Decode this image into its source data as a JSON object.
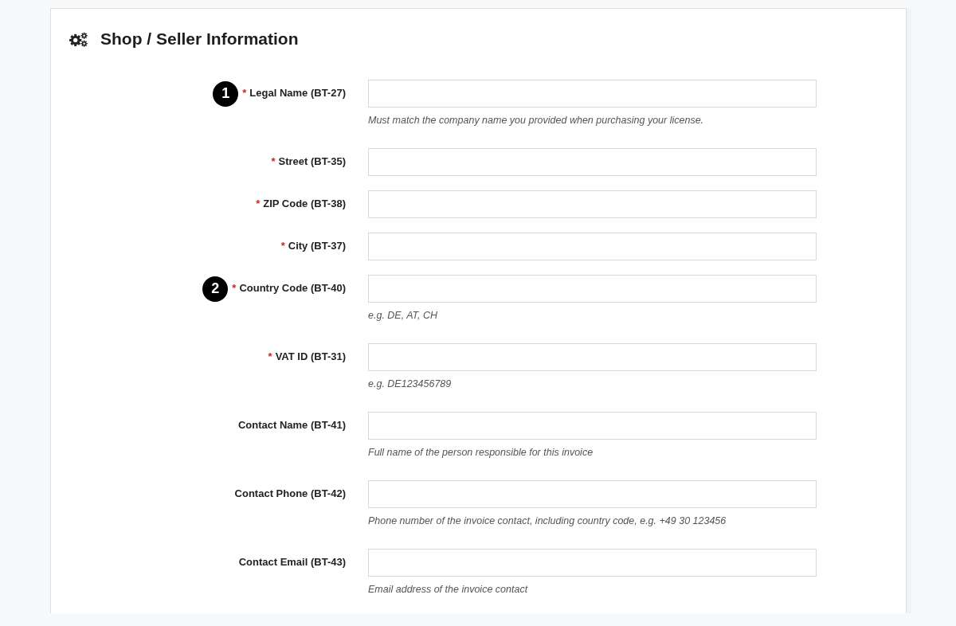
{
  "section": {
    "title": "Shop / Seller Information"
  },
  "fields": [
    {
      "label": "Legal Name (BT-27)",
      "required_mark": "*",
      "badge": "1",
      "help": "Must match the company name you provided when purchasing your license."
    },
    {
      "label": "Street (BT-35)",
      "required_mark": "*"
    },
    {
      "label": "ZIP Code (BT-38)",
      "required_mark": "*"
    },
    {
      "label": "City (BT-37)",
      "required_mark": "*"
    },
    {
      "label": "Country Code (BT-40)",
      "required_mark": "*",
      "badge": "2",
      "help": "e.g. DE, AT, CH"
    },
    {
      "label": "VAT ID (BT-31)",
      "required_mark": "*",
      "help": "e.g. DE123456789"
    },
    {
      "label": "Contact Name (BT-41)",
      "help": "Full name of the person responsible for this invoice"
    },
    {
      "label": "Contact Phone (BT-42)",
      "help": "Phone number of the invoice contact, including country code, e.g. +49 30 123456"
    },
    {
      "label": "Contact Email (BT-43)",
      "help": "Email address of the invoice contact"
    }
  ]
}
